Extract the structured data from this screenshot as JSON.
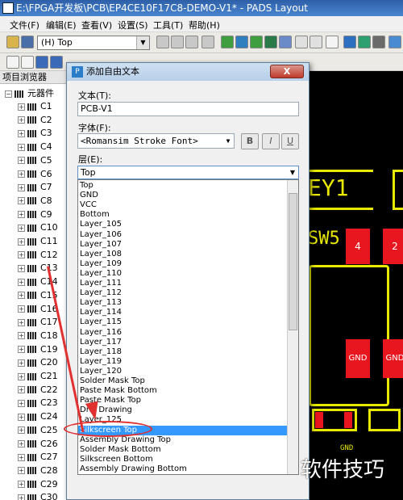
{
  "window": {
    "title": "E:\\FPGA开发板\\PCB\\EP4CE10F17C8-DEMO-V1* - PADS Layout"
  },
  "menu": [
    "文件(F)",
    "编辑(E)",
    "查看(V)",
    "设置(S)",
    "工具(T)",
    "帮助(H)"
  ],
  "toolbar": {
    "layer_value": "(H) Top"
  },
  "panel": {
    "title": "项目浏览器",
    "root": "元器件",
    "components": [
      "C1",
      "C2",
      "C3",
      "C4",
      "C5",
      "C6",
      "C7",
      "C8",
      "C9",
      "C10",
      "C11",
      "C12",
      "C13",
      "C14",
      "C15",
      "C16",
      "C17",
      "C18",
      "C19",
      "C20",
      "C21",
      "C22",
      "C23",
      "C24",
      "C25",
      "C26",
      "C27",
      "C28",
      "C29",
      "C30"
    ]
  },
  "pcb": {
    "labels": [
      "EY1",
      "SW5",
      "4",
      "2",
      "GND",
      "GND",
      "GND"
    ]
  },
  "dialog": {
    "title": "添加自由文本",
    "close": "X",
    "text_label": "文本(T):",
    "text_value": "PCB-V1",
    "font_label": "字体(F):",
    "font_value": "<Romansim Stroke Font>",
    "bold": "B",
    "italic": "I",
    "underline": "U",
    "layer_label": "层(E):",
    "layer_value": "Top",
    "layer_options": [
      "Top",
      "GND",
      "VCC",
      "Bottom",
      "Layer_105",
      "Layer_106",
      "Layer_107",
      "Layer_108",
      "Layer_109",
      "Layer_110",
      "Layer_111",
      "Layer_112",
      "Layer_113",
      "Layer_114",
      "Layer_115",
      "Layer_116",
      "Layer_117",
      "Layer_118",
      "Layer_119",
      "Layer_120",
      "Solder Mask Top",
      "Paste Mask Bottom",
      "Paste Mask Top",
      "Drill Drawing",
      "Layer_125",
      "Silkscreen Top",
      "Assembly Drawing Top",
      "Solder Mask Bottom",
      "Silkscreen Bottom",
      "Assembly Drawing Bottom"
    ],
    "selected_option": "Silkscreen Top"
  },
  "watermark": "软件技巧",
  "colors": {
    "selection": "#3399ff",
    "annotation": "#e03030",
    "silkscreen": "#e8e800",
    "pad": "#e8161e"
  }
}
